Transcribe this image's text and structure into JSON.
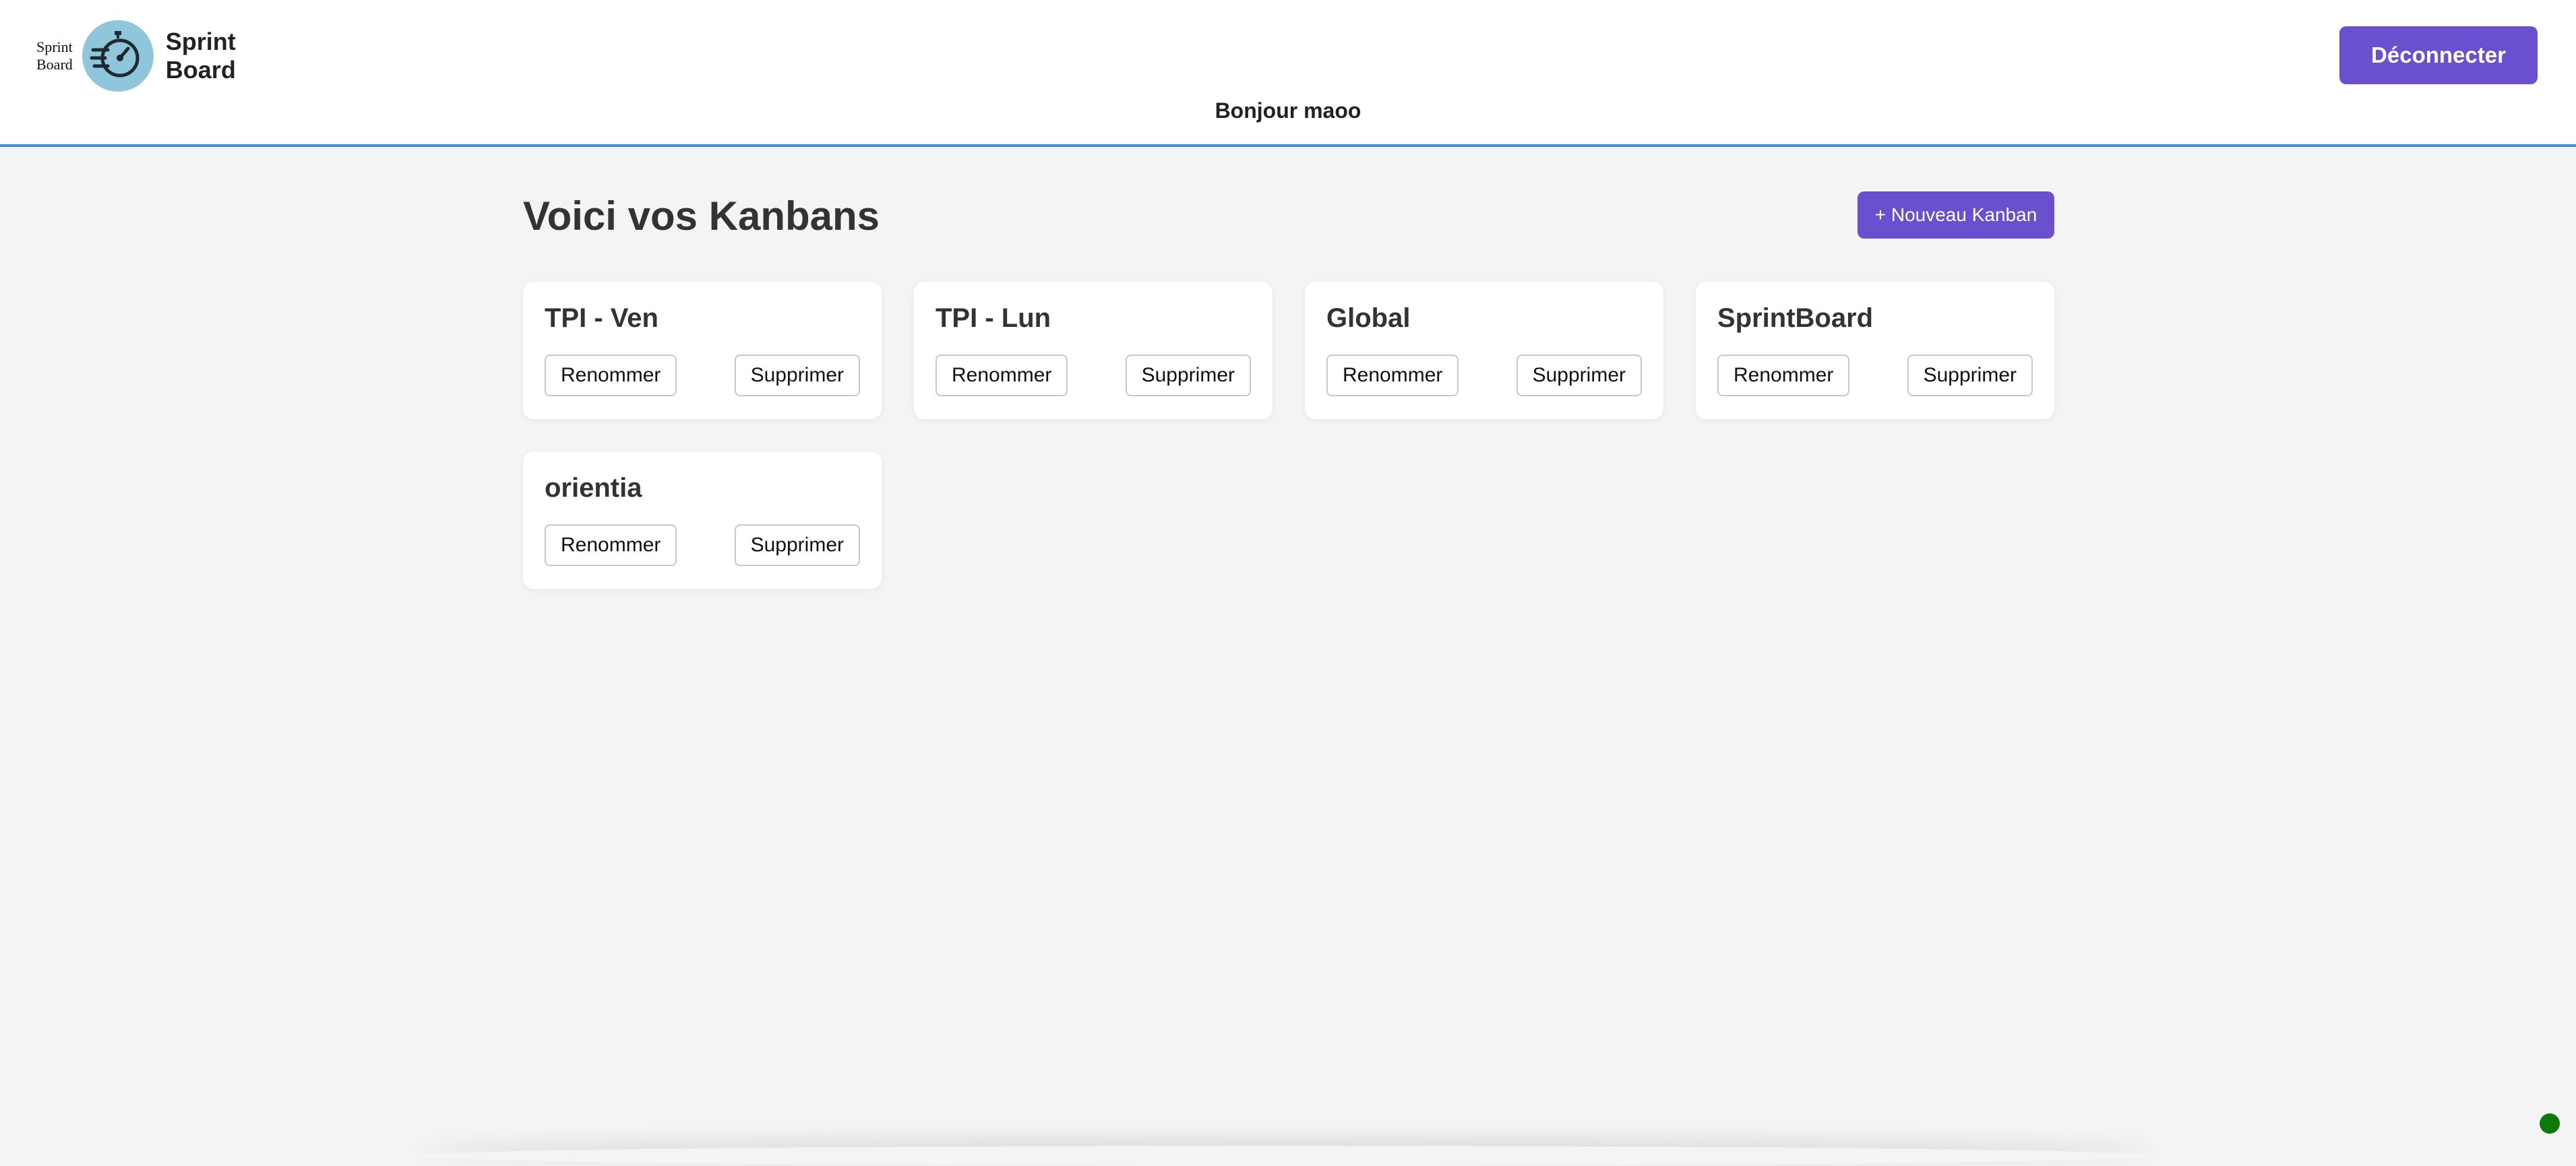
{
  "header": {
    "logo_small_line1": "Sprint",
    "logo_small_line2": "Board",
    "logo_big_line1": "Sprint",
    "logo_big_line2": "Board",
    "logo_icon": "stopwatch-icon",
    "logout_label": "Déconnecter",
    "greeting": "Bonjour maoo"
  },
  "main": {
    "title": "Voici vos Kanbans",
    "new_kanban_label": "+ Nouveau Kanban",
    "kanbans": [
      {
        "name": "TPI - Ven",
        "rename_label": "Renommer",
        "delete_label": "Supprimer"
      },
      {
        "name": "TPI - Lun",
        "rename_label": "Renommer",
        "delete_label": "Supprimer"
      },
      {
        "name": "Global",
        "rename_label": "Renommer",
        "delete_label": "Supprimer"
      },
      {
        "name": "SprintBoard",
        "rename_label": "Renommer",
        "delete_label": "Supprimer"
      },
      {
        "name": "orientia",
        "rename_label": "Renommer",
        "delete_label": "Supprimer"
      }
    ]
  },
  "colors": {
    "accent": "#6a4fcf",
    "header_border": "#3d8fd6",
    "background": "#f4f4f4",
    "logo_circle": "#8fc6dc",
    "status_dot": "#0b7a0b"
  }
}
